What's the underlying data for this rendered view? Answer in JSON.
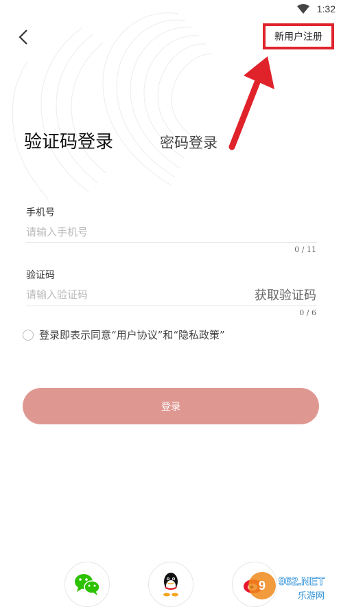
{
  "status_bar": {
    "time": "1:32"
  },
  "header": {
    "register_label": "新用户注册"
  },
  "tabs": {
    "sms_login": "验证码登录",
    "password_login": "密码登录"
  },
  "phone_field": {
    "label": "手机号",
    "placeholder": "请输入手机号",
    "counter": "0 / 11"
  },
  "code_field": {
    "label": "验证码",
    "placeholder": "请输入验证码",
    "counter": "0 / 6",
    "get_code_label": "获取验证码"
  },
  "agreement": {
    "prefix": "登录即表示同意",
    "user_agreement": "“用户协议”",
    "conjunction": "和",
    "privacy_policy": "“隐私政策”"
  },
  "login_button": {
    "label": "登录"
  },
  "social": {
    "icons": [
      "wechat-icon",
      "qq-icon",
      "weibo-icon"
    ]
  },
  "watermark": {
    "text_top": "962.NET",
    "text_bottom": "乐游网"
  },
  "colors": {
    "accent_red": "#e0232b",
    "login_button": "#df9891",
    "wechat_green": "#2dc100"
  }
}
